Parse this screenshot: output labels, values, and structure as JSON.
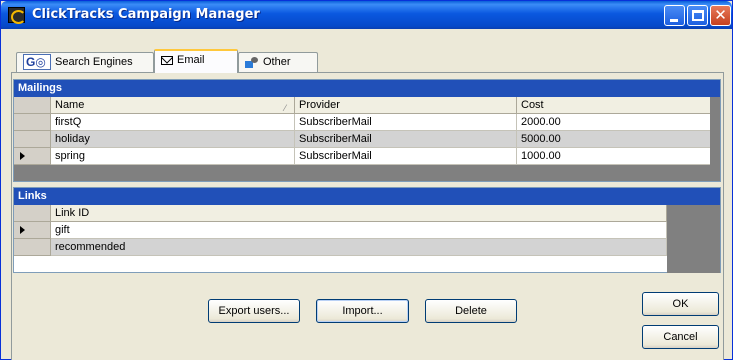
{
  "window": {
    "title": "ClickTracks Campaign Manager"
  },
  "tabs": [
    {
      "label": "Search Engines",
      "icon": "google-icon"
    },
    {
      "label": "Email",
      "icon": "envelope-icon",
      "active": true
    },
    {
      "label": "Other",
      "icon": "other-campaign-icon"
    }
  ],
  "mailings": {
    "header": "Mailings",
    "columns": [
      "Name",
      "Provider",
      "Cost"
    ],
    "rows": [
      {
        "name": "firstQ",
        "provider": "SubscriberMail",
        "cost": "2000.00"
      },
      {
        "name": "holiday",
        "provider": "SubscriberMail",
        "cost": "5000.00"
      },
      {
        "name": "spring",
        "provider": "SubscriberMail",
        "cost": "1000.00",
        "current": true
      }
    ]
  },
  "links": {
    "header": "Links",
    "columns": [
      "Link ID"
    ],
    "rows": [
      {
        "id": "gift",
        "current": true
      },
      {
        "id": "recommended"
      }
    ]
  },
  "buttons": {
    "export": "Export users...",
    "import": "Import...",
    "delete": "Delete",
    "ok": "OK",
    "cancel": "Cancel"
  },
  "colors": {
    "title_bar": "#0a58e0",
    "group_header": "#2150b8",
    "alt_row": "#d3d3d3"
  }
}
